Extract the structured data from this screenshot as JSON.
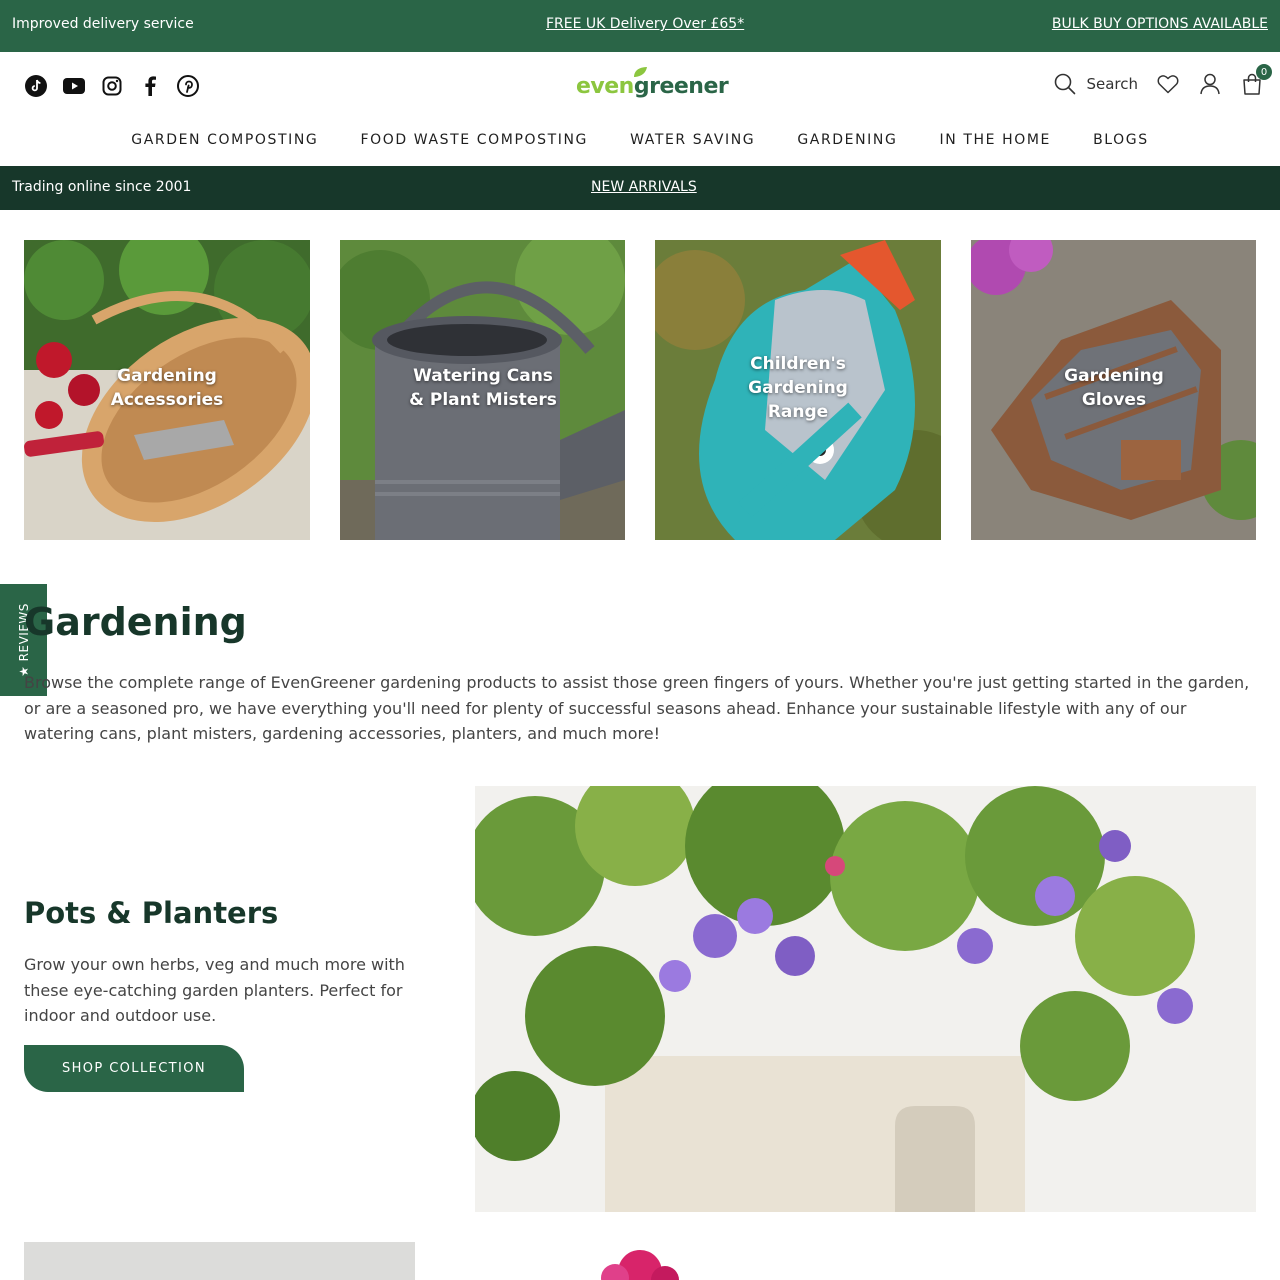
{
  "topbar": {
    "left": "Improved delivery service",
    "center": "FREE UK Delivery Over £65*",
    "right": "BULK BUY OPTIONS AVAILABLE"
  },
  "header": {
    "logo_even": "even",
    "logo_greener": "greener",
    "search_label": "Search",
    "cart_count": "0",
    "socials": [
      "tiktok-icon",
      "youtube-icon",
      "instagram-icon",
      "facebook-icon",
      "pinterest-icon"
    ]
  },
  "nav": {
    "items": [
      "GARDEN COMPOSTING",
      "FOOD WASTE COMPOSTING",
      "WATER SAVING",
      "GARDENING",
      "IN THE HOME",
      "BLOGS"
    ]
  },
  "subbar": {
    "left": "Trading online since 2001",
    "center": "NEW ARRIVALS"
  },
  "categories": [
    {
      "label": "Gardening\nAccessories"
    },
    {
      "label": "Watering Cans\n& Plant Misters"
    },
    {
      "label": "Children's\nGardening\nRange"
    },
    {
      "label": "Gardening\nGloves"
    }
  ],
  "reviews_tab": "★ REVIEWS",
  "page": {
    "title": "Gardening",
    "intro": "Browse the complete range of EvenGreener gardening products to assist those green fingers of yours. Whether you're just getting started in the garden, or are a seasoned pro, we have everything you'll need for plenty of successful seasons ahead. Enhance your sustainable lifestyle with any of our watering cans, plant misters, gardening accessories, planters, and much more!"
  },
  "feature": {
    "title": "Pots & Planters",
    "text": "Grow your own herbs, veg and much more with these eye-catching garden planters. Perfect for indoor and outdoor use.",
    "button": "SHOP COLLECTION"
  },
  "colors": {
    "brand_green": "#2a6547",
    "dark_green": "#17372a",
    "logo_light_green": "#8cc63f"
  }
}
